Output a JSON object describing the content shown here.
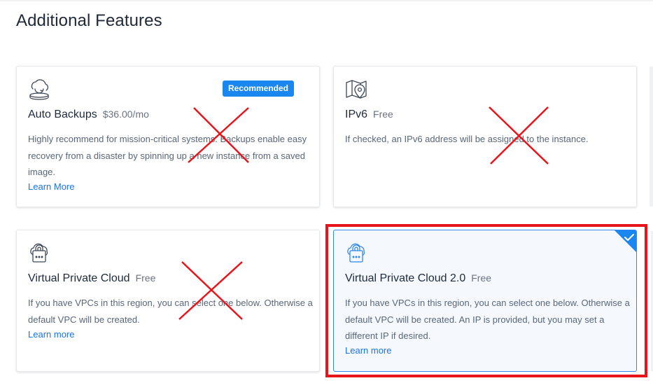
{
  "section": {
    "title": "Additional Features"
  },
  "cards": {
    "auto_backups": {
      "icon": "cloud-backup-icon",
      "title": "Auto Backups",
      "price": "$36.00/mo",
      "badge": "Recommended",
      "description_lines": [
        "Highly recommend for mission-critical systems. Backups enable easy",
        "recovery from a disaster by spinning up a new instance from a saved",
        "image."
      ],
      "link": "Learn More",
      "crossed_out": true
    },
    "ipv6": {
      "icon": "map-pin-icon",
      "title": "IPv6",
      "price": "Free",
      "description_lines": [
        "If checked, an IPv6 address will be assigned to the instance."
      ],
      "crossed_out": true
    },
    "vpc": {
      "icon": "cloud-lock-icon",
      "title": "Virtual Private Cloud",
      "price": "Free",
      "description_lines": [
        "If you have VPCs in this region, you can select one below. Otherwise a",
        "default VPC will be created."
      ],
      "link": "Learn more",
      "crossed_out": true
    },
    "vpc2": {
      "icon": "cloud-lock-icon",
      "title": "Virtual Private Cloud 2.0",
      "price": "Free",
      "description_lines": [
        "If you have VPCs in this region, you can select one below. Otherwise a",
        "default VPC will be created. An IP is provided, but you may set a",
        "different IP if desired."
      ],
      "link": "Learn more",
      "selected": true,
      "highlighted": true
    }
  },
  "colors": {
    "accent": "#1a86f0",
    "link": "#1a73e8",
    "selected_border": "#2f87f0",
    "annotation_red": "#e8141b"
  }
}
